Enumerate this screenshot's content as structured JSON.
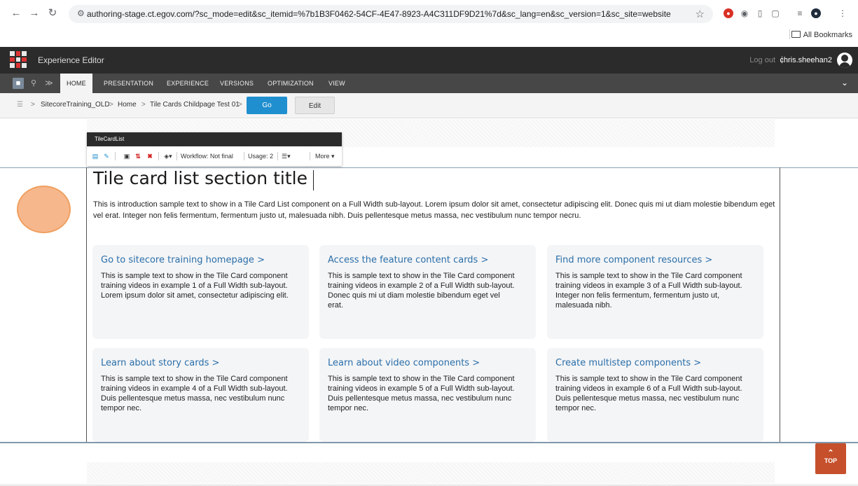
{
  "browser": {
    "url": "authoring-stage.ct.egov.com/?sc_mode=edit&sc_itemid=%7b1B3F0462-54CF-4E47-8923-A4C311DF9D21%7d&sc_lang=en&sc_version=1&sc_site=website",
    "bookmarks_label": "All Bookmarks",
    "icons": [
      "back-icon",
      "forward-icon",
      "reload-icon",
      "site-settings-icon",
      "bookmark-star-icon",
      "extension-icon",
      "camera-icon",
      "reader-icon",
      "extensions-puzzle-icon",
      "tab-search-icon",
      "profile-icon",
      "kebab-menu-icon"
    ]
  },
  "header": {
    "app_title": "Experience Editor",
    "logout": "Log out",
    "separator": "|",
    "username": "chris.sheehan2"
  },
  "ribbon": {
    "tabs": [
      "HOME",
      "PRESENTATION",
      "EXPERIENCE",
      "VERSIONS",
      "OPTIMIZATION",
      "VIEW"
    ],
    "active_tab": "HOME"
  },
  "breadcrumb": {
    "items": [
      "SitecoreTraining_OLD",
      "Home",
      "Tile Cards Childpage Test 01"
    ],
    "separator": ">",
    "go_label": "Go",
    "edit_label": "Edit"
  },
  "chrome": {
    "component_name": "TileCardList",
    "workflow": "Workflow: Not final",
    "usage": "Usage: 2",
    "more": "More"
  },
  "section": {
    "title": "Tile card list section title",
    "intro": "This is introduction sample text to show in a Tile Card List component on a Full Width sub-layout. Lorem ipsum dolor sit amet, consectetur adipiscing elit. Donec quis mi ut diam molestie bibendum eget vel erat. Integer non felis fermentum, fermentum justo ut, malesuada nibh. Duis pellentesque metus massa, nec vestibulum nunc tempor necru."
  },
  "cards": [
    {
      "title": "Go to sitecore training homepage",
      "text": "This is sample text to show in the Tile Card component training videos in example 1 of a Full Width sub-layout. Lorem ipsum dolor sit amet, consectetur adipiscing elit."
    },
    {
      "title": "Access the feature content cards",
      "text": "This is sample text to show in the Tile Card component training videos in example 2 of a Full Width sub-layout. Donec quis mi ut diam molestie bibendum eget vel erat."
    },
    {
      "title": "Find more component resources",
      "text": "This is sample text to show in the Tile Card component training videos in example 3 of a Full Width sub-layout. Integer non felis fermentum, fermentum justo ut, malesuada nibh."
    },
    {
      "title": "Learn about story cards",
      "text": "This is sample text to show in the Tile Card component training videos in example 4 of a Full Width sub-layout. Duis pellentesque metus massa, nec vestibulum nunc tempor nec."
    },
    {
      "title": "Learn about video components",
      "text": "This is sample text to show in the Tile Card component training videos in example 5 of a Full Width sub-layout. Duis pellentesque metus massa, nec vestibulum nunc tempor nec."
    },
    {
      "title": "Create multistep components",
      "text": "This is sample text to show in the Tile Card component training videos in example 6 of a Full Width sub-layout. Duis pellentesque metus massa, nec vestibulum nunc tempor nec."
    }
  ],
  "card_link_suffix": ">",
  "top_button": {
    "label": "TOP"
  },
  "colors": {
    "go_button": "#1f8fcf",
    "card_title": "#2a6ea8",
    "top_button": "#c6502b",
    "header": "#2b2b2b",
    "ribbon": "#474747"
  }
}
